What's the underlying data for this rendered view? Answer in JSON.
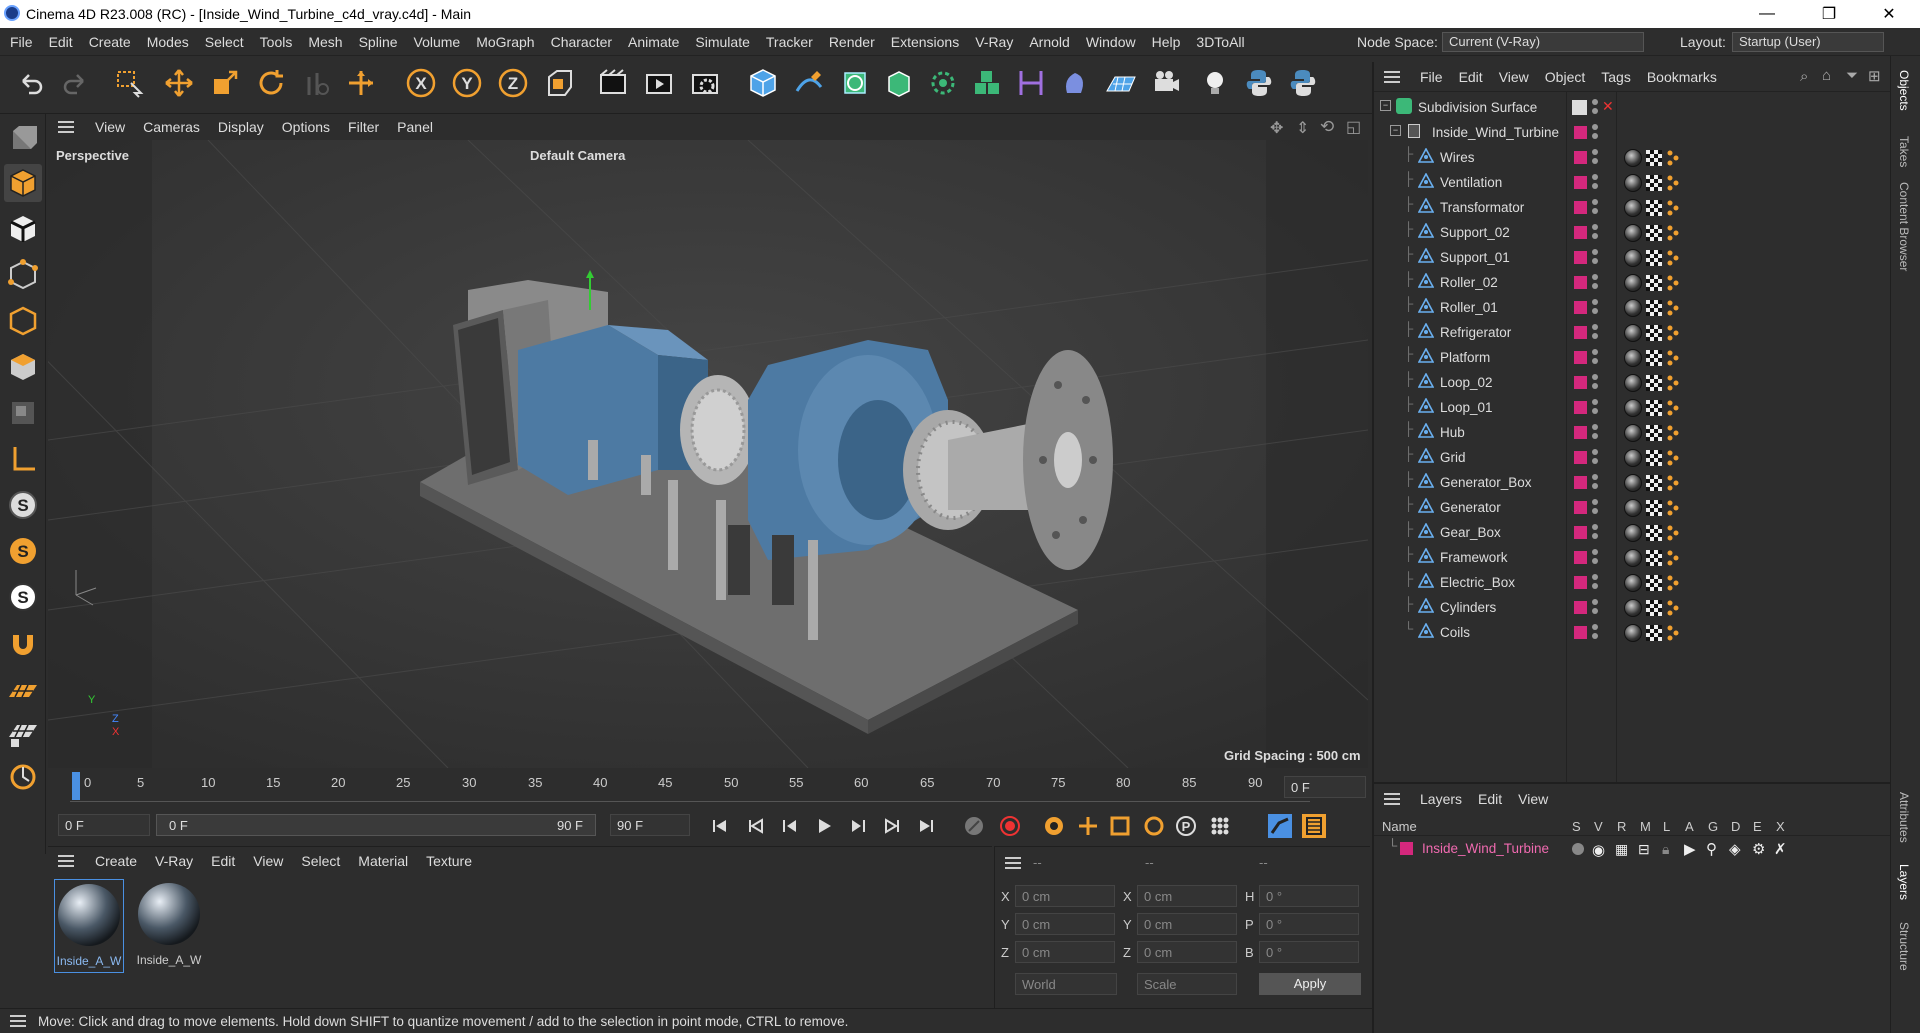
{
  "window": {
    "title": "Cinema 4D R23.008 (RC) - [Inside_Wind_Turbine_c4d_vray.c4d] - Main",
    "minimize": "—",
    "maximize": "❐",
    "close": "✕"
  },
  "menubar": {
    "items": [
      "File",
      "Edit",
      "Create",
      "Modes",
      "Select",
      "Tools",
      "Mesh",
      "Spline",
      "Volume",
      "MoGraph",
      "Character",
      "Animate",
      "Simulate",
      "Tracker",
      "Render",
      "Extensions",
      "V-Ray",
      "Arnold",
      "Window",
      "Help",
      "3DToAll"
    ],
    "node_space_label": "Node Space:",
    "node_space_value": "Current (V-Ray)",
    "layout_label": "Layout:",
    "layout_value": "Startup (User)"
  },
  "viewport": {
    "menu": [
      "View",
      "Cameras",
      "Display",
      "Options",
      "Filter",
      "Panel"
    ],
    "view_name": "Perspective",
    "camera": "Default Camera",
    "grid_spacing": "Grid Spacing : 500 cm",
    "axis_y": "Y",
    "axis_z": "Z",
    "axis_x": "X"
  },
  "timeline": {
    "ticks": [
      "0",
      "5",
      "10",
      "15",
      "20",
      "25",
      "30",
      "35",
      "40",
      "45",
      "50",
      "55",
      "60",
      "65",
      "70",
      "75",
      "80",
      "85",
      "90"
    ],
    "current_frame": "0 F"
  },
  "transport": {
    "start_field": "0 F",
    "range_start": "0 F",
    "range_end": "90 F",
    "end_field": "90 F"
  },
  "materials": {
    "menu": [
      "Create",
      "V-Ray",
      "Edit",
      "View",
      "Select",
      "Material",
      "Texture"
    ],
    "items": [
      {
        "label": "Inside_A_W"
      },
      {
        "label": "Inside_A_W"
      }
    ]
  },
  "coords": {
    "header": [
      "--",
      "--",
      "--"
    ],
    "rows": [
      {
        "a": "X",
        "a_val": "0 cm",
        "b": "X",
        "b_val": "0 cm",
        "c": "H",
        "c_val": "0 °"
      },
      {
        "a": "Y",
        "a_val": "0 cm",
        "b": "Y",
        "b_val": "0 cm",
        "c": "P",
        "c_val": "0 °"
      },
      {
        "a": "Z",
        "a_val": "0 cm",
        "b": "Z",
        "b_val": "0 cm",
        "c": "B",
        "c_val": "0 °"
      }
    ],
    "world": "World",
    "scale": "Scale",
    "apply": "Apply"
  },
  "status": "Move: Click and drag to move elements. Hold down SHIFT to quantize movement / add to the selection in point mode, CTRL to remove.",
  "objects": {
    "menu": [
      "File",
      "Edit",
      "View",
      "Object",
      "Tags",
      "Bookmarks"
    ],
    "root": "Subdivision Surface",
    "group": "Inside_Wind_Turbine",
    "children": [
      "Wires",
      "Ventilation",
      "Transformator",
      "Support_02",
      "Support_01",
      "Roller_02",
      "Roller_01",
      "Refrigerator",
      "Platform",
      "Loop_02",
      "Loop_01",
      "Hub",
      "Grid",
      "Generator_Box",
      "Generator",
      "Gear_Box",
      "Framework",
      "Electric_Box",
      "Cylinders",
      "Coils"
    ]
  },
  "layers": {
    "menu": [
      "Layers",
      "Edit",
      "View"
    ],
    "name_header": "Name",
    "columns": [
      "S",
      "V",
      "R",
      "M",
      "L",
      "A",
      "G",
      "D",
      "E",
      "X"
    ],
    "items": [
      {
        "name": "Inside_Wind_Turbine"
      }
    ]
  },
  "side_tabs": [
    "Objects",
    "Takes",
    "Content Browser",
    "Attributes",
    "Layers",
    "Structure"
  ],
  "colors": {
    "accent": "#4a90e2",
    "layer_pink": "#d4287d",
    "bg": "#2d2d2d"
  }
}
